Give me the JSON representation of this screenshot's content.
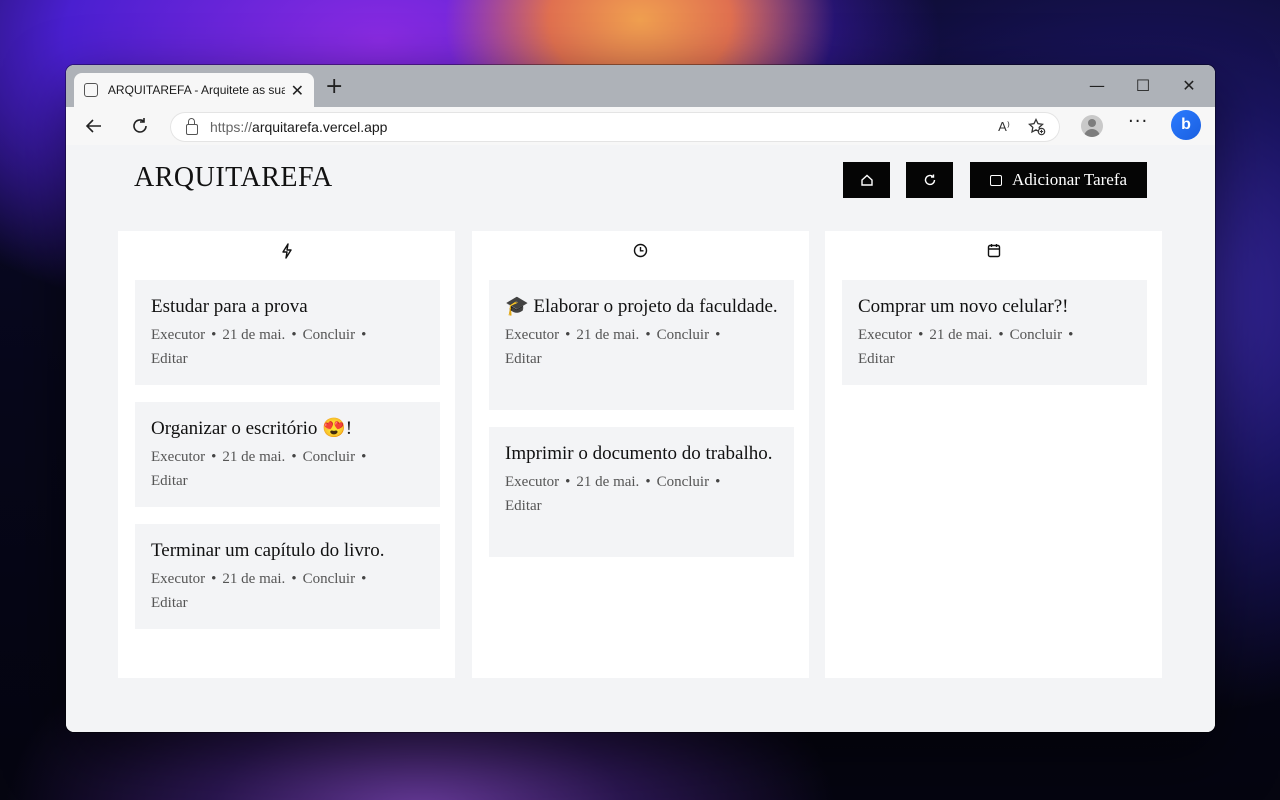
{
  "browser": {
    "tab_title": "ARQUITAREFA - Arquitete as suas",
    "tab_close": "✕",
    "new_tab": "+",
    "url_scheme": "https://",
    "url_host": "arquitarefa.vercel.app",
    "read_aloud": "A⁾",
    "win_minimize": "—",
    "win_maximize": "☐",
    "win_close": "✕",
    "more": "···",
    "bing": "b"
  },
  "app": {
    "brand": "ARQUITAREFA",
    "add_task_label": "Adicionar Tarefa"
  },
  "columns": [
    {
      "icon": "lightning-icon",
      "cards": [
        {
          "title": "Estudar para a prova",
          "executor": "Executor",
          "date": "21 de mai.",
          "complete": "Concluir",
          "edit": "Editar"
        },
        {
          "title": "Organizar o escritório 😍!",
          "executor": "Executor",
          "date": "21 de mai.",
          "complete": "Concluir",
          "edit": "Editar"
        },
        {
          "title": "Terminar um capítulo do livro.",
          "executor": "Executor",
          "date": "21 de mai.",
          "complete": "Concluir",
          "edit": "Editar"
        }
      ]
    },
    {
      "icon": "clock-icon",
      "cards": [
        {
          "title": "🎓 Elaborar o projeto da faculdade.",
          "executor": "Executor",
          "date": "21 de mai.",
          "complete": "Concluir",
          "edit": "Editar"
        },
        {
          "title": "Imprimir o documento do trabalho.",
          "executor": "Executor",
          "date": "21 de mai.",
          "complete": "Concluir",
          "edit": "Editar"
        }
      ]
    },
    {
      "icon": "calendar-icon",
      "cards": [
        {
          "title": "Comprar um novo celular?!",
          "executor": "Executor",
          "date": "21 de mai.",
          "complete": "Concluir",
          "edit": "Editar"
        }
      ]
    }
  ],
  "meta_separator": "•"
}
